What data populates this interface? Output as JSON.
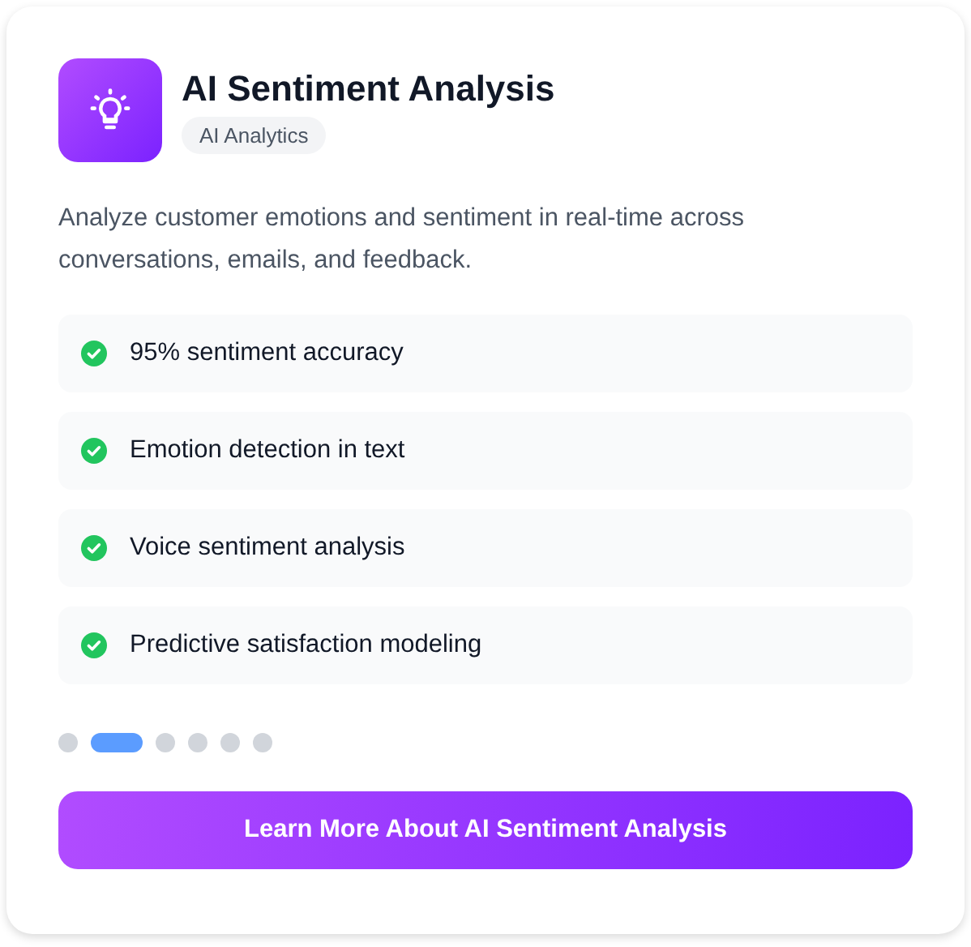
{
  "card": {
    "title": "AI Sentiment Analysis",
    "category": "AI Analytics",
    "description": "Analyze customer emotions and sentiment in real-time across conversations, emails, and feedback.",
    "features": [
      {
        "text": "95% sentiment accuracy"
      },
      {
        "text": "Emotion detection in text"
      },
      {
        "text": "Voice sentiment analysis"
      },
      {
        "text": "Predictive satisfaction modeling"
      }
    ],
    "pagination": [
      {
        "selected": false
      },
      {
        "selected": true
      },
      {
        "selected": false
      },
      {
        "selected": false
      },
      {
        "selected": false
      },
      {
        "selected": false
      }
    ],
    "button": "Learn More About AI Sentiment Analysis"
  }
}
